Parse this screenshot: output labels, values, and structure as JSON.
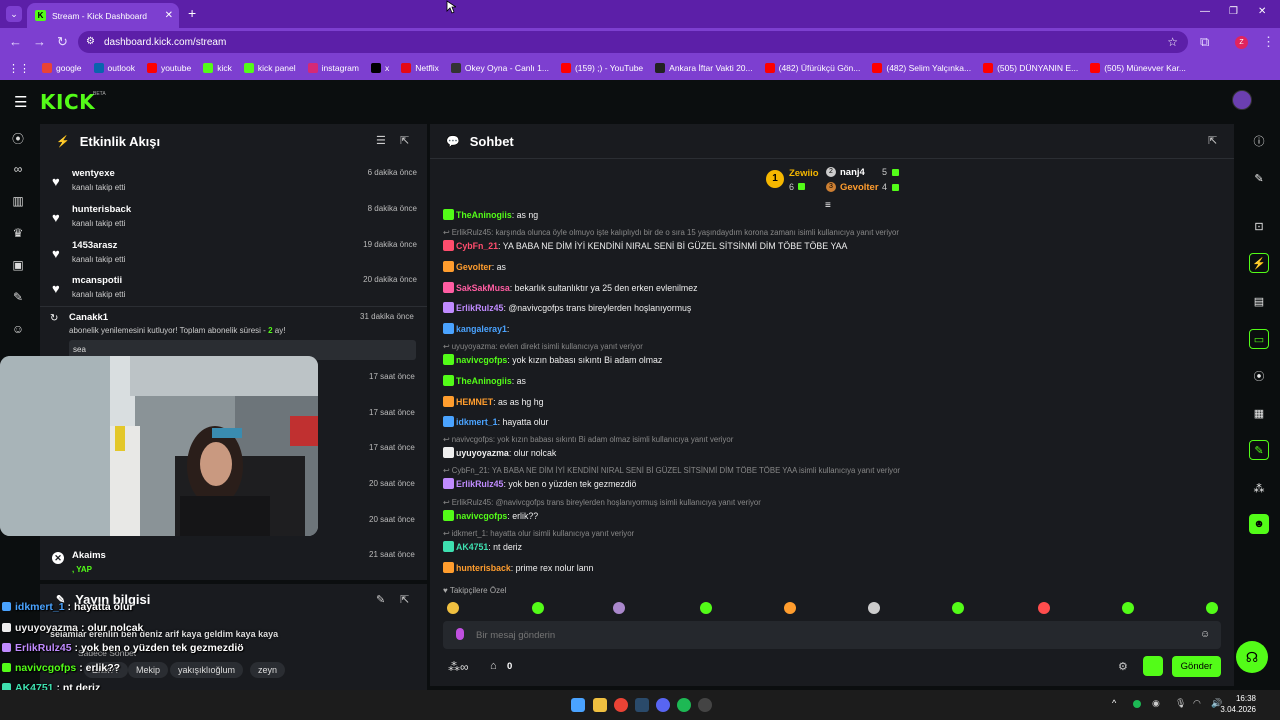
{
  "browser": {
    "tab_title": "Stream - Kick Dashboard",
    "url": "dashboard.kick.com/stream",
    "bookmarks": [
      {
        "label": "google",
        "color": "#ea4335",
        "icon": "google-icon"
      },
      {
        "label": "outlook",
        "color": "#0a64ad",
        "icon": "outlook-icon"
      },
      {
        "label": "youtube",
        "color": "#ff0000",
        "icon": "youtube-icon"
      },
      {
        "label": "kick",
        "color": "#53fc18",
        "icon": "kick-icon"
      },
      {
        "label": "kick panel",
        "color": "#53fc18",
        "icon": "kick-icon"
      },
      {
        "label": "instagram",
        "color": "#d62976",
        "icon": "instagram-icon"
      },
      {
        "label": "x",
        "color": "#000000",
        "icon": "x-icon"
      },
      {
        "label": "Netflix",
        "color": "#e50914",
        "icon": "netflix-icon"
      },
      {
        "label": "Okey Oyna - Canlı 1...",
        "color": "#333333",
        "icon": "okey-icon"
      },
      {
        "label": "(159) ;) - YouTube",
        "color": "#ff0000",
        "icon": "youtube-icon"
      },
      {
        "label": "Ankara İftar Vakti 20...",
        "color": "#222222",
        "icon": "site-icon"
      },
      {
        "label": "(482) Üfürükçü Gön...",
        "color": "#ff0000",
        "icon": "youtube-icon"
      },
      {
        "label": "(482) Selim Yalçınka...",
        "color": "#ff0000",
        "icon": "youtube-icon"
      },
      {
        "label": "(505) DÜNYANIN E...",
        "color": "#ff0000",
        "icon": "youtube-icon"
      },
      {
        "label": "(505) Münevver Kar...",
        "color": "#ff0000",
        "icon": "youtube-icon"
      }
    ]
  },
  "app": {
    "logo": "KICK",
    "logo_badge": "BETA",
    "accent": "#53fc18"
  },
  "activity": {
    "title": "Etkinlik Akışı",
    "items": [
      {
        "name": "wentyexe",
        "sub": "kanalı takip etti",
        "time": "6 dakika önce"
      },
      {
        "name": "hunterisback",
        "sub": "kanalı takip etti",
        "time": "8 dakika önce"
      },
      {
        "name": "1453arasz",
        "sub": "kanalı takip etti",
        "time": "19 dakika önce"
      },
      {
        "name": "mcanspotii",
        "sub": "kanalı takip etti",
        "time": "20 dakika önce"
      }
    ],
    "sub_item": {
      "name": "Canakk1",
      "text": "abonelik yenilemesini kutluyor! Toplam abonelik süresi - ",
      "months": "2",
      "months_suffix": " ay!",
      "time": "31 dakika önce",
      "message": "sea"
    },
    "partial_times": [
      "17 saat önce",
      "17 saat önce",
      "17 saat önce",
      "20 saat önce",
      "20 saat önce"
    ],
    "last_item": {
      "name": "Akaims",
      "sub": ", YAP",
      "time": "21 saat önce"
    }
  },
  "stream_info": {
    "title": "Yayın bilgisi",
    "stream_title": "selamlar erenlin ben deniz arif kaya geldim kaya kaya",
    "subtitle": "Sadece Sohbet",
    "tags": [
      "Erlik??",
      "Mekip",
      "yakışıklıoğlum",
      "zeyn"
    ]
  },
  "chat": {
    "title": "Sohbet",
    "leaderboard": [
      {
        "name": "Zewiio",
        "count": "6"
      },
      {
        "name": "nanj4",
        "count": "5"
      },
      {
        "name": "Gevolter",
        "count": "4"
      }
    ],
    "messages": [
      {
        "user": "TheAninogiis",
        "color": "#53fc18",
        "text": ": as ng"
      },
      {
        "reply": "ErlikRulz45: karşında olunca öyle olmuyo işte kalıplıydı bir de o sıra 15 yaşındaydım korona zamanı isimli kullanıcıya yanıt veriyor"
      },
      {
        "user": "CybFn_21",
        "color": "#ff4d6d",
        "text": ": YA BABA NE DİM İYİ KENDİNİ NIRAL SENİ Bİ GÜZEL SİTSİNMİ DİM TÖBE TÖBE YAA"
      },
      {
        "user": "Gevolter",
        "color": "#ff9d2e",
        "text": ": as"
      },
      {
        "user": "SakSakMusa",
        "color": "#ff5da2",
        "text": ": bekarlık sultanlıktır ya 25 den erken evlenilmez"
      },
      {
        "user": "ErlikRulz45",
        "color": "#c08bff",
        "text": ": @navivcgofps trans bireylerden hoşlanıyormuş"
      },
      {
        "user": "kangaleray1",
        "color": "#4aa3ff",
        "text": ":"
      },
      {
        "reply": "uyuyoyazma: evlen direkt isimli kullanıcıya yanıt veriyor"
      },
      {
        "user": "navivcgofps",
        "color": "#53fc18",
        "text": ": yok kızın babası sıkıntı Bi adam olmaz"
      },
      {
        "user": "TheAninogiis",
        "color": "#53fc18",
        "text": ": as"
      },
      {
        "user": "HEMNET",
        "color": "#ff9d2e",
        "text": ": as as hg hg"
      },
      {
        "user": "idkmert_1",
        "color": "#4aa3ff",
        "text": ": hayatta olur"
      },
      {
        "reply": "navivcgofps: yok kızın babası sıkıntı Bi adam olmaz isimli kullanıcıya yanıt veriyor"
      },
      {
        "user": "uyuyoyazma",
        "color": "#eeeeee",
        "text": ": olur nolcak"
      },
      {
        "reply": "CybFn_21: YA BABA NE DİM İYİ KENDİNİ NIRAL SENİ Bİ GÜZEL SİTSİNMİ DİM TÖBE TÖBE YAA isimli kullanıcıya yanıt veriyor"
      },
      {
        "user": "ErlikRulz45",
        "color": "#c08bff",
        "text": ": yok ben o yüzden tek gezmezdiö"
      },
      {
        "reply": "ErlikRulz45: @navivcgofps trans bireylerden hoşlanıyormuş isimli kullanıcıya yanıt veriyor"
      },
      {
        "user": "navivcgofps",
        "color": "#53fc18",
        "text": ": erlik??"
      },
      {
        "reply": "idkmert_1: hayatta olur isimli kullanıcıya yanıt veriyor"
      },
      {
        "user": "AK4751",
        "color": "#3ee0b0",
        "text": ": nt deriz"
      },
      {
        "user": "hunterisback",
        "color": "#ff9d2e",
        "text": ": prime rex nolur lann"
      }
    ],
    "followers_only": "Takipçilere Özel",
    "input_placeholder": "Bir mesaj gönderin",
    "points": "0",
    "send_label": "Gönder"
  },
  "overlay_chat": [
    {
      "user": "idkmert_1",
      "color": "#4aa3ff",
      "text": " : hayatta olur"
    },
    {
      "user": "uyuyoyazma",
      "color": "#eeeeee",
      "text": " : olur nolcak"
    },
    {
      "user": "ErlikRulz45",
      "color": "#c08bff",
      "text": " : yok ben o yüzden tek gezmezdiö"
    },
    {
      "user": "navivcgofps",
      "color": "#53fc18",
      "text": " : erlik??"
    },
    {
      "user": "AK4751",
      "color": "#3ee0b0",
      "text": " : nt deriz"
    },
    {
      "user": "hunterisback",
      "color": "#ff9d2e",
      "text": " : prime rex nolur lann"
    }
  ],
  "taskbar": {
    "time": "16:38",
    "date": "3.04.2026"
  }
}
